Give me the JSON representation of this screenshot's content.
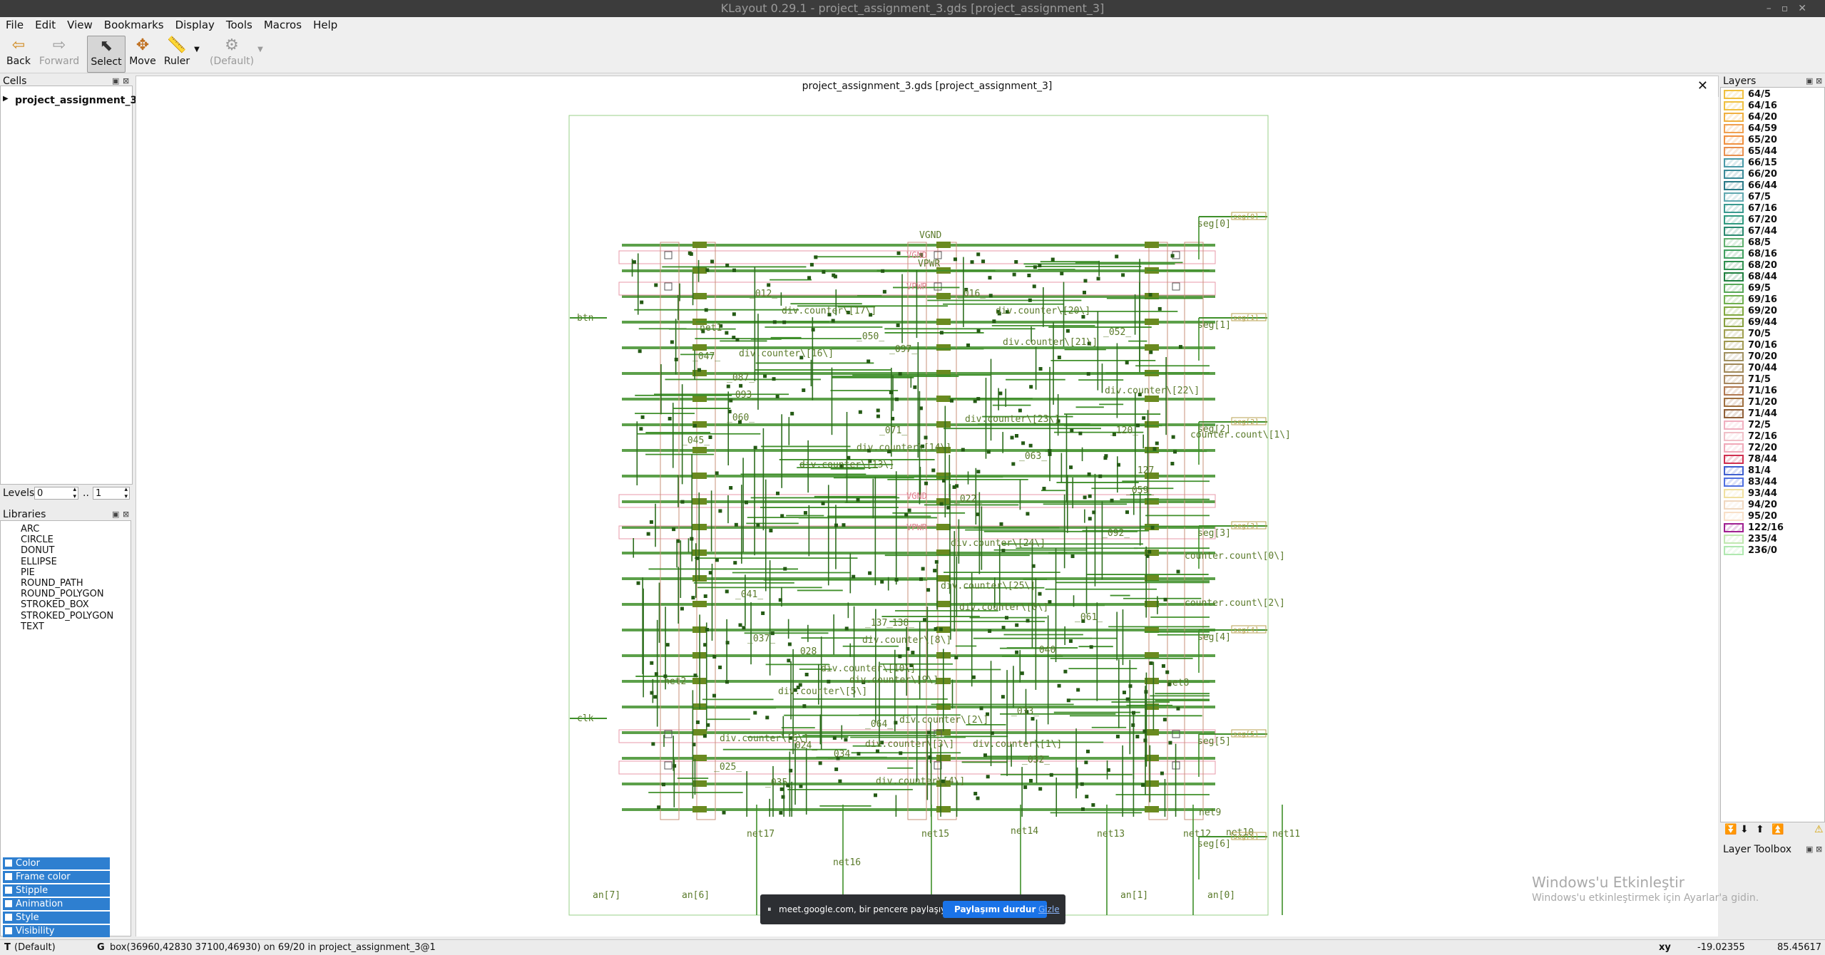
{
  "window": {
    "title": "KLayout 0.29.1 - project_assignment_3.gds [project_assignment_3]"
  },
  "menu": [
    "File",
    "Edit",
    "View",
    "Bookmarks",
    "Display",
    "Tools",
    "Macros",
    "Help"
  ],
  "toolbar": {
    "back": "Back",
    "forward": "Forward",
    "select": "Select",
    "move": "Move",
    "ruler": "Ruler",
    "default": "(Default)"
  },
  "cells": {
    "title": "Cells",
    "top_cell": "project_assignment_3"
  },
  "levels": {
    "label": "Levels",
    "from": "0",
    "separator": "..",
    "to": "1"
  },
  "libraries": {
    "title": "Libraries",
    "items": [
      "ARC",
      "CIRCLE",
      "DONUT",
      "ELLIPSE",
      "PIE",
      "ROUND_PATH",
      "ROUND_POLYGON",
      "STROKED_BOX",
      "STROKED_POLYGON",
      "TEXT"
    ]
  },
  "document": {
    "tab_title": "project_assignment_3.gds [project_assignment_3]"
  },
  "layout_labels": {
    "power": [
      "VGND",
      "VPWR",
      "VGND",
      "VPWR",
      "VGND",
      "VPWR"
    ],
    "nets": [
      "net17",
      "net16",
      "net15",
      "net14",
      "net13",
      "net12",
      "net11",
      "net8",
      "net2",
      "net1",
      "net10",
      "net9"
    ],
    "pins": [
      "an[7]",
      "an[6]",
      "an[1]",
      "an[0]",
      "btn",
      "clk",
      "seg[0]",
      "seg[1]",
      "seg[2]",
      "seg[3]",
      "seg[4]",
      "seg[5]",
      "seg[6]"
    ],
    "seg_boxes": [
      "seg[0]",
      "seg[1]",
      "seg[2]",
      "seg[3]",
      "seg[4]",
      "seg[5]",
      "seg[6]"
    ],
    "signals": [
      "div.counter\\[17\\]",
      "div.counter\\[20\\]",
      "div.counter\\[21\\]",
      "div.counter\\[16\\]",
      "div.counter\\[22\\]",
      "div.counter\\[23\\]",
      "div.counter\\[14\\]",
      "div.counter\\[13\\]",
      "counter.count\\[1\\]",
      "div.counter\\[24\\]",
      "counter.count\\[0\\]",
      "div.counter\\[25\\]",
      "div.counter\\[0\\]",
      "counter.count\\[2\\]",
      "div.counter\\[8\\]",
      "div.counter\\[10\\]",
      "div.counter\\[5\\]",
      "div.counter\\[2\\]",
      "div.counter\\[3\\]",
      "div.counter\\[1\\]",
      "div.counter\\[4\\]",
      "div.counter\\[9\\]",
      "div.counter\\[6\\]",
      "_012_",
      "_016_",
      "_052_",
      "_050_",
      "_097_",
      "_047_",
      "_087_",
      "_093_",
      "_120_",
      "_063_",
      "_127_",
      "_022_",
      "_059_",
      "_092_",
      "_041_",
      "_061_",
      "_137_",
      "_138_",
      "_040_",
      "_037_",
      "_028_",
      "_064_",
      "_033_",
      "_024_",
      "_034_",
      "_032_",
      "_025_",
      "_035_",
      "_045_",
      "_060_",
      "_071_"
    ]
  },
  "layers": {
    "title": "Layers",
    "items": [
      {
        "name": "64/5",
        "color": "#f0c040"
      },
      {
        "name": "64/16",
        "color": "#f0c040"
      },
      {
        "name": "64/20",
        "color": "#f0b040"
      },
      {
        "name": "64/59",
        "color": "#f0a050"
      },
      {
        "name": "65/20",
        "color": "#f09040"
      },
      {
        "name": "65/44",
        "color": "#e89050"
      },
      {
        "name": "66/15",
        "color": "#4a9aa8"
      },
      {
        "name": "66/20",
        "color": "#3a8a98"
      },
      {
        "name": "66/44",
        "color": "#2a7a88"
      },
      {
        "name": "67/5",
        "color": "#60a8b0"
      },
      {
        "name": "67/16",
        "color": "#3a9a90"
      },
      {
        "name": "67/20",
        "color": "#309a80"
      },
      {
        "name": "67/44",
        "color": "#2a8a70"
      },
      {
        "name": "68/5",
        "color": "#60b070"
      },
      {
        "name": "68/16",
        "color": "#40a060"
      },
      {
        "name": "68/20",
        "color": "#309050"
      },
      {
        "name": "68/44",
        "color": "#208040"
      },
      {
        "name": "69/5",
        "color": "#58a858"
      },
      {
        "name": "69/16",
        "color": "#70b050"
      },
      {
        "name": "69/20",
        "color": "#80a840"
      },
      {
        "name": "69/44",
        "color": "#88a040"
      },
      {
        "name": "70/5",
        "color": "#a0a050"
      },
      {
        "name": "70/16",
        "color": "#a09850"
      },
      {
        "name": "70/20",
        "color": "#a09060"
      },
      {
        "name": "70/44",
        "color": "#a08858"
      },
      {
        "name": "71/5",
        "color": "#a88860"
      },
      {
        "name": "71/16",
        "color": "#b07850"
      },
      {
        "name": "71/20",
        "color": "#a07040"
      },
      {
        "name": "71/44",
        "color": "#906038"
      },
      {
        "name": "72/5",
        "color": "#f0b0c0"
      },
      {
        "name": "72/16",
        "color": "#f0c0c8"
      },
      {
        "name": "72/20",
        "color": "#f0a8b8"
      },
      {
        "name": "78/44",
        "color": "#d03050"
      },
      {
        "name": "81/4",
        "color": "#4060d0"
      },
      {
        "name": "83/44",
        "color": "#5070e0"
      },
      {
        "name": "93/44",
        "color": "#f0e0a0"
      },
      {
        "name": "94/20",
        "color": "#f0d8c0"
      },
      {
        "name": "95/20",
        "color": "#f8e0c8"
      },
      {
        "name": "122/16",
        "color": "#a02090"
      },
      {
        "name": "235/4",
        "color": "#c0e8b0"
      },
      {
        "name": "236/0",
        "color": "#b0e8b0"
      }
    ]
  },
  "layer_toolbox": {
    "title": "Layer Toolbox",
    "items": [
      "Color",
      "Frame color",
      "Stipple",
      "Animation",
      "Style",
      "Visibility"
    ]
  },
  "status": {
    "mode_key": "T",
    "mode": "(Default)",
    "grid_key": "G",
    "message": "box(36960,42830 37100,46930) on 69/20 in project_assignment_3@1",
    "coord_key": "xy",
    "x": "-19.02355",
    "y": "85.45617"
  },
  "screen_share": {
    "message": "meet.google.com, bir pencere paylaşıyor.",
    "stop": "Paylaşımı durdur",
    "hide": "Gizle"
  },
  "activation": {
    "title": "Windows'u Etkinleştir",
    "subtitle": "Windows'u etkinleştirmek için Ayarlar'a gidin."
  }
}
